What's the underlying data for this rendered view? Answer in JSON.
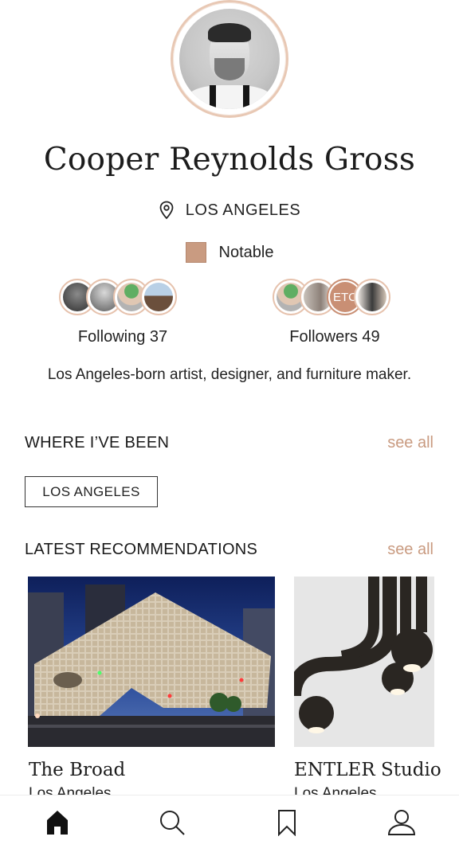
{
  "profile": {
    "name": "Cooper Reynolds Gross",
    "location": "LOS ANGELES",
    "badge": "Notable",
    "bio": "Los Angeles-born artist, designer, and furniture maker."
  },
  "social": {
    "following_label": "Following 37",
    "followers_label": "Followers 49",
    "etc_label": "ETC"
  },
  "where_been": {
    "title": "WHERE I’VE BEEN",
    "see_all": "see all",
    "tags": [
      "LOS ANGELES"
    ]
  },
  "recommendations": {
    "title": "LATEST RECOMMENDATIONS",
    "see_all": "see all",
    "items": [
      {
        "title": "The Broad",
        "subtitle": "Los Angeles"
      },
      {
        "title": "ENTLER Studio",
        "subtitle": "Los Angeles"
      }
    ]
  },
  "tabbar": {
    "icons": [
      "home-icon",
      "search-icon",
      "bookmark-icon",
      "profile-icon"
    ]
  },
  "colors": {
    "accent": "#c99b81",
    "ring": "#e6c2ad"
  }
}
